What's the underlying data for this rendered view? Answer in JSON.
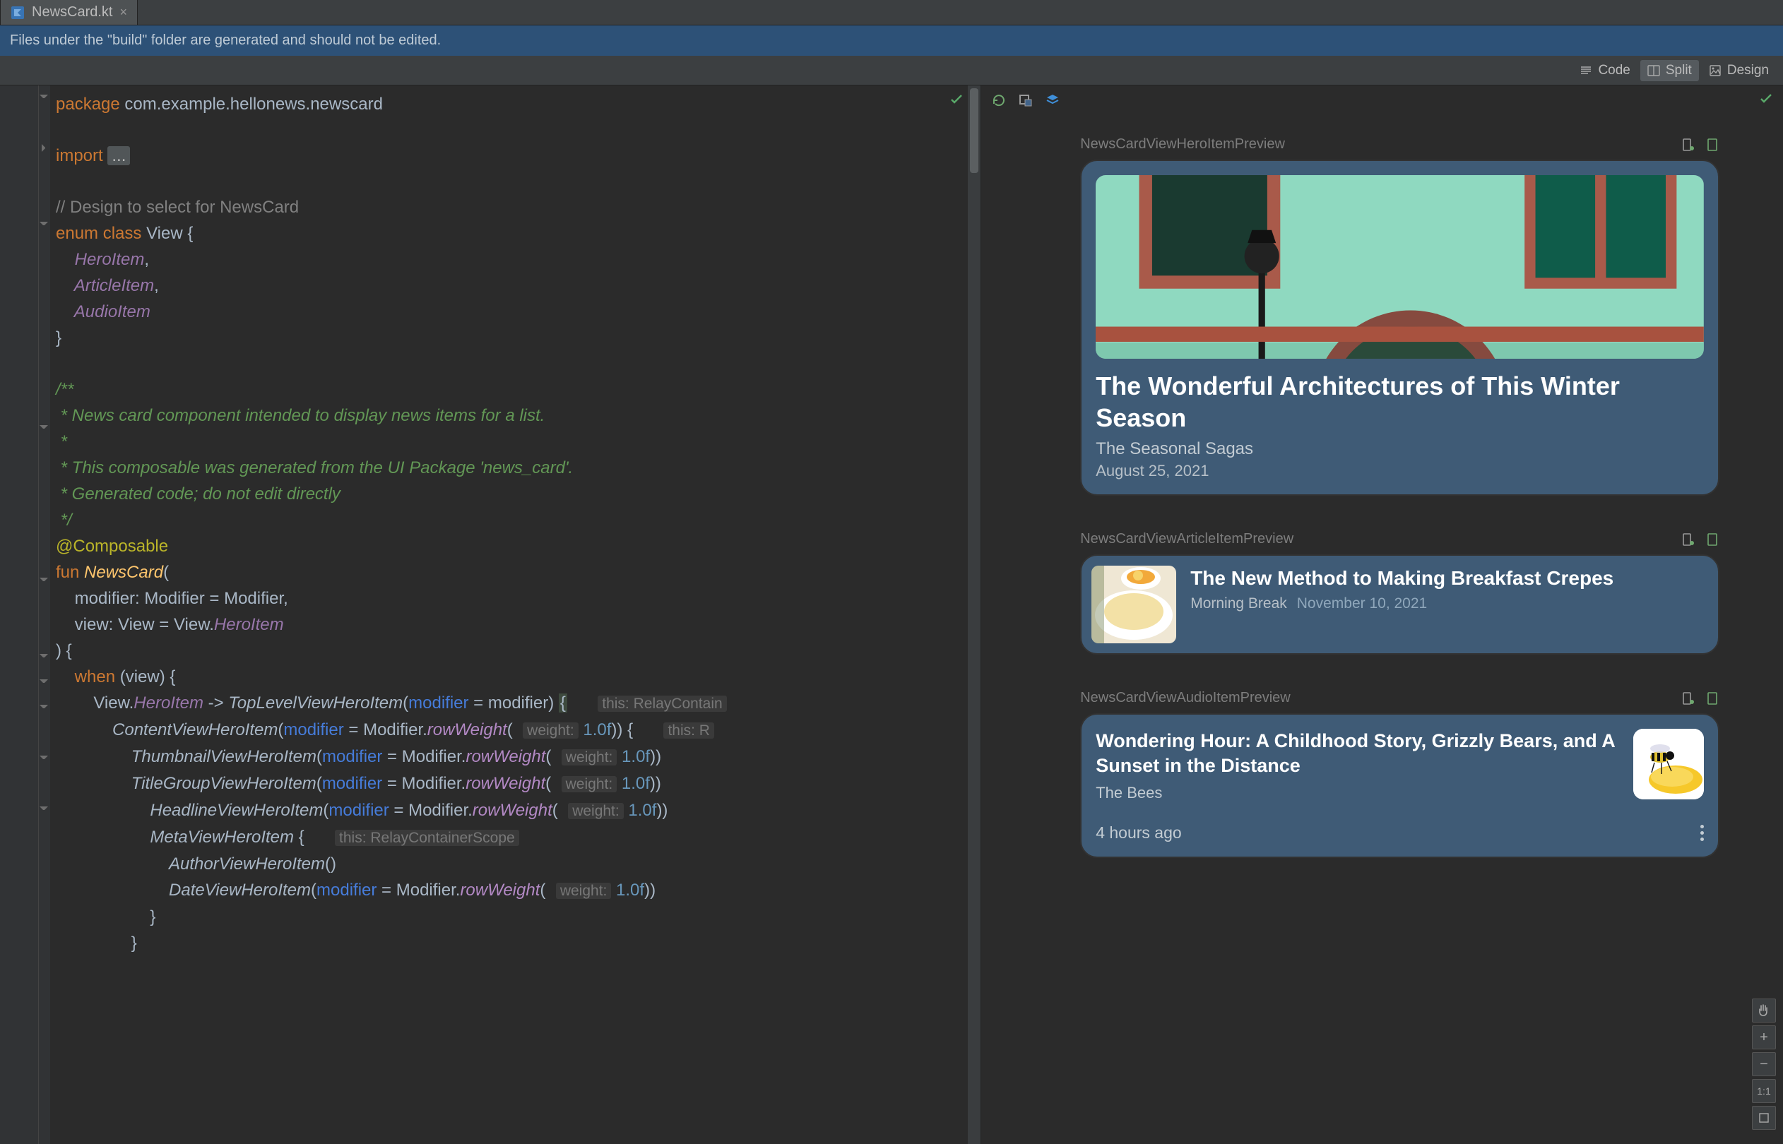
{
  "tab": {
    "filename": "NewsCard.kt"
  },
  "banner": {
    "text": "Files under the \"build\" folder are generated and should not be edited."
  },
  "viewSwitch": {
    "code": "Code",
    "split": "Split",
    "design": "Design",
    "active": "split"
  },
  "code": {
    "l1a": "package ",
    "l1b": "com.example.hellonews.newscard",
    "l2a": "import ",
    "l2b": "...",
    "l3": "// Design to select for NewsCard",
    "l4a": "enum class ",
    "l4b": "View {",
    "l5": "    HeroItem",
    "l5c": ",",
    "l6": "    ArticleItem",
    "l6c": ",",
    "l7": "    AudioItem",
    "l8": "}",
    "d1": "/**",
    "d2": " * News card component intended to display news items for a list.",
    "d3": " *",
    "d4": " * This composable was generated from the UI Package 'news_card'.",
    "d5": " * Generated code; do not edit directly",
    "d6": " */",
    "a1": "@Composable",
    "f1a": "fun ",
    "f1b": "NewsCard",
    "f1c": "(",
    "f2": "    modifier: Modifier = Modifier,",
    "f3a": "    view: View = View.",
    "f3b": "HeroItem",
    "f4": ") {",
    "w1a": "    when ",
    "w1b": "(view) {",
    "w2a": "        View.",
    "w2b": "HeroItem",
    "w2c": " -> ",
    "w2d": "TopLevelViewHeroItem",
    "w2e": "(",
    "w2f": "modifier",
    "w2g": " = modifier) ",
    "w2h": "{",
    "w2hint": "this: RelayContain",
    "w3a": "            ",
    "w3b": "ContentViewHeroItem",
    "w3c": "(",
    "w3d": "modifier",
    "w3e": " = Modifier.",
    "w3f": "rowWeight",
    "w3g": "(",
    "w3h": "weight:",
    "w3i": " 1.0f",
    "w3j": ")) {",
    "w3hint": "this: R",
    "w4a": "                ",
    "w4b": "ThumbnailViewHeroItem",
    "w4c": "(",
    "w4d": "modifier",
    "w4e": " = Modifier.",
    "w4f": "rowWeight",
    "w4g": "(",
    "w4h": "weight:",
    "w4i": " 1.0f",
    "w4j": "))",
    "w5a": "                ",
    "w5b": "TitleGroupViewHeroItem",
    "w5c": "(",
    "w5d": "modifier",
    "w5e": " = Modifier.",
    "w5f": "rowWeight",
    "w5g": "(",
    "w5h": "weight:",
    "w5i": " 1.0f",
    "w5j": ")) ",
    "w6a": "                    ",
    "w6b": "HeadlineViewHeroItem",
    "w6c": "(",
    "w6d": "modifier",
    "w6e": " = Modifier.",
    "w6f": "rowWeight",
    "w6g": "(",
    "w6h": "weight:",
    "w6i": " 1.0f",
    "w6j": "))",
    "w7a": "                    ",
    "w7b": "MetaViewHeroItem",
    "w7c": " {",
    "w7hint": "this: RelayContainerScope",
    "w8a": "                        ",
    "w8b": "AuthorViewHeroItem",
    "w8c": "()",
    "w9a": "                        ",
    "w9b": "DateViewHeroItem",
    "w9c": "(",
    "w9d": "modifier",
    "w9e": " = Modifier.",
    "w9f": "rowWeight",
    "w9g": "(",
    "w9h": "weight:",
    "w9i": " 1.0f",
    "w9j": "))",
    "w10": "                    }",
    "w11": "                }"
  },
  "previews": {
    "hero": {
      "label": "NewsCardViewHeroItemPreview",
      "headline": "The Wonderful Architectures of This Winter Season",
      "author": "The Seasonal Sagas",
      "date": "August 25, 2021"
    },
    "article": {
      "label": "NewsCardViewArticleItemPreview",
      "headline": "The New Method to Making Breakfast Crepes",
      "author": "Morning Break",
      "date": "November 10, 2021"
    },
    "audio": {
      "label": "NewsCardViewAudioItemPreview",
      "headline": "Wondering Hour: A Childhood Story, Grizzly Bears, and A Sunset in the Distance",
      "author": "The Bees",
      "ago": "4 hours ago"
    }
  },
  "zoom": {
    "ratio": "1:1"
  }
}
